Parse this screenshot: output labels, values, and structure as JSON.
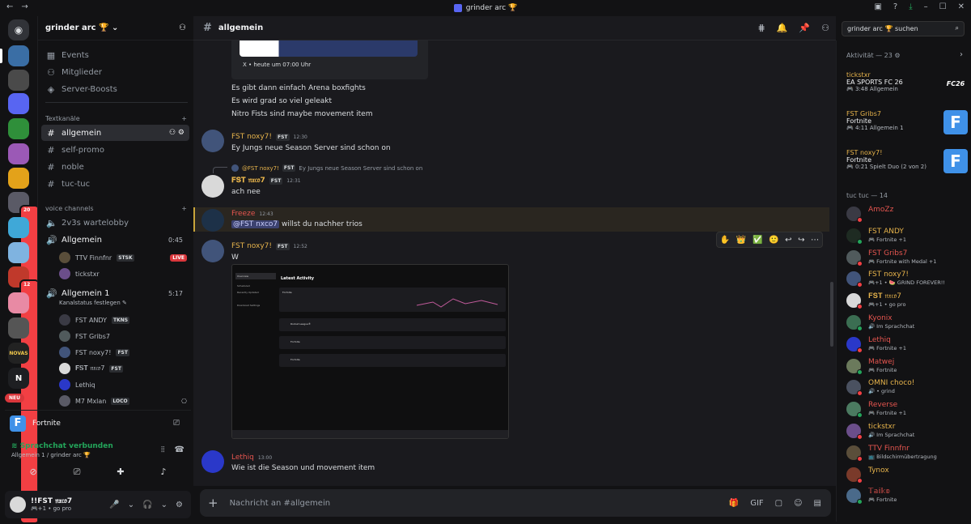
{
  "window": {
    "title": "grinder arc 🏆"
  },
  "server": {
    "name": "grinder arc 🏆"
  },
  "sidebar": {
    "top_items": [
      {
        "label": "Events",
        "icon": "calendar-icon"
      },
      {
        "label": "Mitglieder",
        "icon": "members-icon"
      },
      {
        "label": "Server-Boosts",
        "icon": "boost-icon"
      }
    ],
    "text_category": "Textkanäle",
    "text_channels": [
      "allgemein",
      "self-promo",
      "noble",
      "tuc-tuc"
    ],
    "voice_category": "voice channels",
    "voice_channels": [
      {
        "name": "2v3s wartelobby"
      },
      {
        "name": "Allgemein",
        "time": "0:45"
      },
      {
        "name": "Allgemein 1",
        "time": "5:17",
        "sub": "Kanalstatus festlegen"
      }
    ],
    "voice_users_a": [
      {
        "name": "TTV Finnfnr",
        "tag": "STSK",
        "live": "LIVE"
      },
      {
        "name": "tickstxr",
        "tag": "",
        "live": ""
      }
    ],
    "voice_users_b": [
      {
        "name": "FST ANDY",
        "tag": "TKNS"
      },
      {
        "name": "FST Gribs7",
        "tag": ""
      },
      {
        "name": "FST noxy7!",
        "tag": "FST"
      },
      {
        "name": "𝐅𝐒𝐓 𝔫𝔵𝔠𝔬7",
        "tag": "FST"
      },
      {
        "name": "Lethiq",
        "tag": ""
      },
      {
        "name": "M7 Mxlan",
        "tag": "LOCO"
      }
    ]
  },
  "activity": {
    "game": "Fortnite"
  },
  "voice_panel": {
    "status": "Sprachchat verbunden",
    "sub": "Allgemein 1 / grinder arc 🏆"
  },
  "user_panel": {
    "name": "!!FST 𝔫𝔵𝔠𝔬7",
    "status": "🎮+1 • go pro"
  },
  "channel": {
    "name": "allgemein"
  },
  "search": {
    "placeholder": "grinder arc 🏆 suchen"
  },
  "embed": {
    "footer": "X • heute um 07:00 Uhr"
  },
  "messages": {
    "m0": [
      "Es gibt dann einfach Arena boxfights",
      "Es wird grad so viel geleakt",
      "Nitro Fists sind maybe movement item"
    ],
    "m1": {
      "author": "FST noxy7!",
      "tag": "FST",
      "time": "12:30",
      "text": "Ey Jungs neue Season Server sind schon on"
    },
    "m2": {
      "reply_author": "@FST noxy7!",
      "reply_tag": "FST",
      "reply_text": "Ey Jungs neue Season Server sind schon on",
      "author": "𝐅𝐒𝐓 𝔫𝔵𝔠𝔬7",
      "tag": "FST",
      "time": "12:31",
      "text": "ach nee"
    },
    "m3": {
      "author": "Freeze",
      "time": "12:43",
      "mention": "@FST nxco7",
      "text": " willst du nachher trios"
    },
    "m4": {
      "author": "FST noxy7!",
      "tag": "FST",
      "time": "12:52",
      "text": "W"
    },
    "m5": {
      "author": "Lethiq",
      "time": "13:00",
      "text": "Wie ist die Season und movement item"
    }
  },
  "screenshot": {
    "title": "Latest Activity",
    "nav": [
      "Overview",
      "Scheduled",
      "Recently Updated",
      "Download Settings"
    ],
    "rows": [
      "Fortnite",
      "Rocket League®",
      "Fortnite",
      "Fortnite"
    ]
  },
  "hover_bar": [
    "✋",
    "👑",
    "✅",
    "🙂",
    "↩",
    "↪",
    "⋯"
  ],
  "input": {
    "placeholder": "Nachricht an #allgemein"
  },
  "members": {
    "activity_header": "Aktivität — 23",
    "activities": [
      {
        "name": "tickstxr",
        "game": "EA SPORTS FC 26",
        "time": "3:48",
        "ch": "Allgemein",
        "logo": "FC26"
      },
      {
        "name": "FST Gribs7",
        "game": "Fortnite",
        "time": "4:11",
        "ch": "Allgemein 1",
        "logo": "F"
      },
      {
        "name": "FST noxy7!",
        "game": "Fortnite",
        "time": "0:21",
        "ch": "Spielt Duo (2 von 2)",
        "logo": "F"
      }
    ],
    "role_header": "tuc tuc — 14",
    "list": [
      {
        "name": "AmoZz",
        "status": "",
        "color": "#e5554f",
        "av": "#3a3a44",
        "dot": "#f23f43"
      },
      {
        "name": "FST ANDY",
        "status": "🎮 Fortnite +1",
        "color": "#e6b34b",
        "av": "#1e2b22",
        "dot": "#23a55a"
      },
      {
        "name": "FST Gribs7",
        "status": "🎮 Fortnite with Medal +1",
        "color": "#e5554f",
        "av": "#505a5c",
        "dot": "#f23f43"
      },
      {
        "name": "FST noxy7!",
        "status": "🎮+1 • 🍉 GRIND FOREVER!!",
        "color": "#e6b34b",
        "av": "#41547a",
        "dot": "#f23f43"
      },
      {
        "name": "𝐅𝐒𝐓 𝔫𝔵𝔠𝔬7",
        "status": "🎮+1 • go pro",
        "color": "#e6b34b",
        "av": "#d9d9d9",
        "dot": "#f23f43"
      },
      {
        "name": "Kyonix",
        "status": "🔊 Im Sprachchat",
        "color": "#e5554f",
        "av": "#3b6e52",
        "dot": "#23a55a"
      },
      {
        "name": "Lethiq",
        "status": "🎮 Fortnite +1",
        "color": "#e5554f",
        "av": "#2a38c9",
        "dot": "#f23f43"
      },
      {
        "name": "Matwej",
        "status": "🎮 Fortnite",
        "color": "#e5554f",
        "av": "#6b7a5c",
        "dot": "#23a55a"
      },
      {
        "name": "OMNI choco!",
        "status": "🔊 • grind",
        "color": "#e6b34b",
        "av": "#4a5160",
        "dot": "#f23f43"
      },
      {
        "name": "Reverse",
        "status": "🎮 Fortnite +1",
        "color": "#e5554f",
        "av": "#4b7a60",
        "dot": "#23a55a"
      },
      {
        "name": "tickstxr",
        "status": "🔊 Im Sprachchat",
        "color": "#e6b34b",
        "av": "#6b4e8a",
        "dot": "#f23f43"
      },
      {
        "name": "TTV Finnfnr",
        "status": "📺 Bildschirmübertragung",
        "color": "#e5554f",
        "av": "#5a4e3a",
        "dot": "#f23f43"
      },
      {
        "name": "Tynox",
        "status": "",
        "color": "#e6b34b",
        "av": "#7a3a2a",
        "dot": "#f23f43"
      },
      {
        "name": "𝕋𝕒𝕚𝕜𝕠",
        "status": "🎮 Fortnite",
        "color": "#e5554f",
        "av": "#4a6a8a",
        "dot": "#23a55a"
      }
    ]
  },
  "servers": [
    {
      "c": "#3a6ea5",
      "active": true
    },
    {
      "c": "#4a4a4a"
    },
    {
      "c": "#5865f2"
    },
    {
      "c": "#2f8f3a"
    },
    {
      "c": "#9b59b6"
    },
    {
      "c": "#e3a21a"
    },
    {
      "c": "#5a5a66",
      "badge": "20"
    },
    {
      "c": "#3fa8d8"
    },
    {
      "c": "#7fb3e0"
    },
    {
      "c": "#c0392b",
      "badge": "12"
    },
    {
      "c": "#e88aa4"
    },
    {
      "c": "#555"
    },
    {
      "c": "#222",
      "label": "NOVAS"
    },
    {
      "c": "#1e1f22",
      "label": "N"
    }
  ],
  "new_badge": "NEU"
}
